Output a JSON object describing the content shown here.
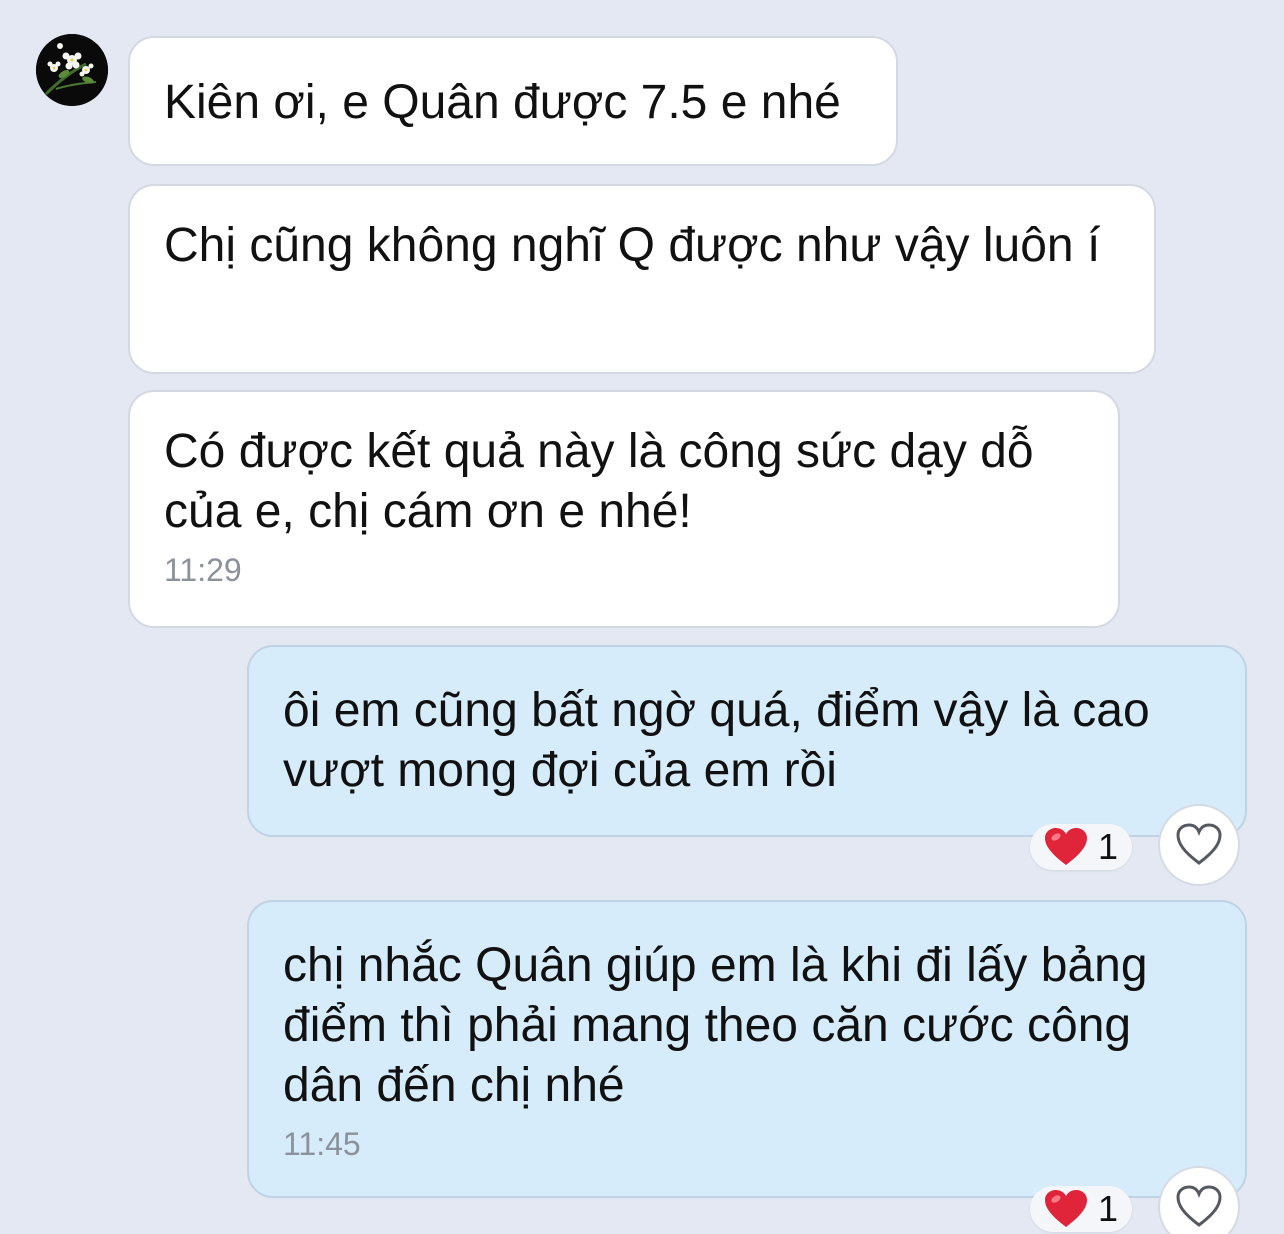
{
  "messages": [
    {
      "text": "Kiên ơi, e Quân được 7.5 e nhé"
    },
    {
      "text": "Chị cũng không nghĩ Q được như vậy luôn í"
    },
    {
      "text": "Có được kết quả này là công sức dạy dỗ của e, chị cám ơn e nhé!",
      "time": "11:29"
    },
    {
      "text": "ôi em cũng bất ngờ quá, điểm vậy là cao vượt mong đợi của em rồi",
      "reaction_count": "1"
    },
    {
      "text": "chị nhắc Quân giúp em là khi đi lấy bảng điểm thì phải mang theo căn cước công dân đến chị nhé",
      "time": "11:45",
      "reaction_count": "1"
    }
  ],
  "reaction_icon": "heart-emoji",
  "like_icon": "heart-outline-icon",
  "colors": {
    "background": "#e3e8f2",
    "incoming_bubble": "#ffffff",
    "outgoing_bubble": "#d6ecfb",
    "heart": "#e0243a"
  }
}
